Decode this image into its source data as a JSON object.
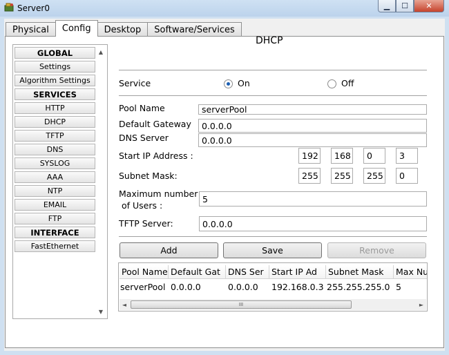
{
  "window": {
    "title": "Server0",
    "controls": {
      "minimize": "▁",
      "maximize": "☐",
      "close": "✕"
    }
  },
  "tabs": [
    {
      "label": "Physical",
      "active": false
    },
    {
      "label": "Config",
      "active": true
    },
    {
      "label": "Desktop",
      "active": false
    },
    {
      "label": "Software/Services",
      "active": false
    }
  ],
  "sidebar": {
    "items": [
      {
        "label": "GLOBAL",
        "header": true
      },
      {
        "label": "Settings",
        "header": false
      },
      {
        "label": "Algorithm Settings",
        "header": false
      },
      {
        "label": "SERVICES",
        "header": true
      },
      {
        "label": "HTTP",
        "header": false
      },
      {
        "label": "DHCP",
        "header": false
      },
      {
        "label": "TFTP",
        "header": false
      },
      {
        "label": "DNS",
        "header": false
      },
      {
        "label": "SYSLOG",
        "header": false
      },
      {
        "label": "AAA",
        "header": false
      },
      {
        "label": "NTP",
        "header": false
      },
      {
        "label": "EMAIL",
        "header": false
      },
      {
        "label": "FTP",
        "header": false
      },
      {
        "label": "INTERFACE",
        "header": true
      },
      {
        "label": "FastEthernet",
        "header": false
      }
    ],
    "scroll_up": "▲",
    "scroll_down": "▼"
  },
  "dhcp": {
    "title": "DHCP",
    "service_label": "Service",
    "on_label": "On",
    "off_label": "Off",
    "service_state": "On",
    "pool_name_label": "Pool Name",
    "pool_name_value": "serverPool",
    "default_gateway_label": "Default Gateway",
    "default_gateway_value": "0.0.0.0",
    "dns_server_label": "DNS Server",
    "dns_server_value": "0.0.0.0",
    "start_ip_label": "Start IP Address :",
    "start_ip_octets": [
      "192",
      "168",
      "0",
      "3"
    ],
    "subnet_mask_label": "Subnet Mask:",
    "subnet_mask_octets": [
      "255",
      "255",
      "255",
      "0"
    ],
    "max_users_label_line1": "Maximum number",
    "max_users_label_line2": "of Users :",
    "max_users_value": "5",
    "tftp_server_label": "TFTP Server:",
    "tftp_server_value": "0.0.0.0",
    "buttons": {
      "add": "Add",
      "save": "Save",
      "remove": "Remove"
    }
  },
  "pool_table": {
    "headers": [
      "Pool Name",
      "Default Gat",
      "DNS Ser",
      "Start IP Ad",
      "Subnet Mask",
      "Max Nu"
    ],
    "rows": [
      [
        "serverPool",
        "0.0.0.0",
        "0.0.0.0",
        "192.168.0.3",
        "255.255.255.0",
        "5"
      ]
    ],
    "scroll_left": "◄",
    "scroll_right": "►",
    "scroll_grip": "III"
  },
  "colors": {
    "titlebar": "#bcd3ec",
    "close_button": "#c6432c",
    "radio_selected": "#1c5fb3"
  }
}
